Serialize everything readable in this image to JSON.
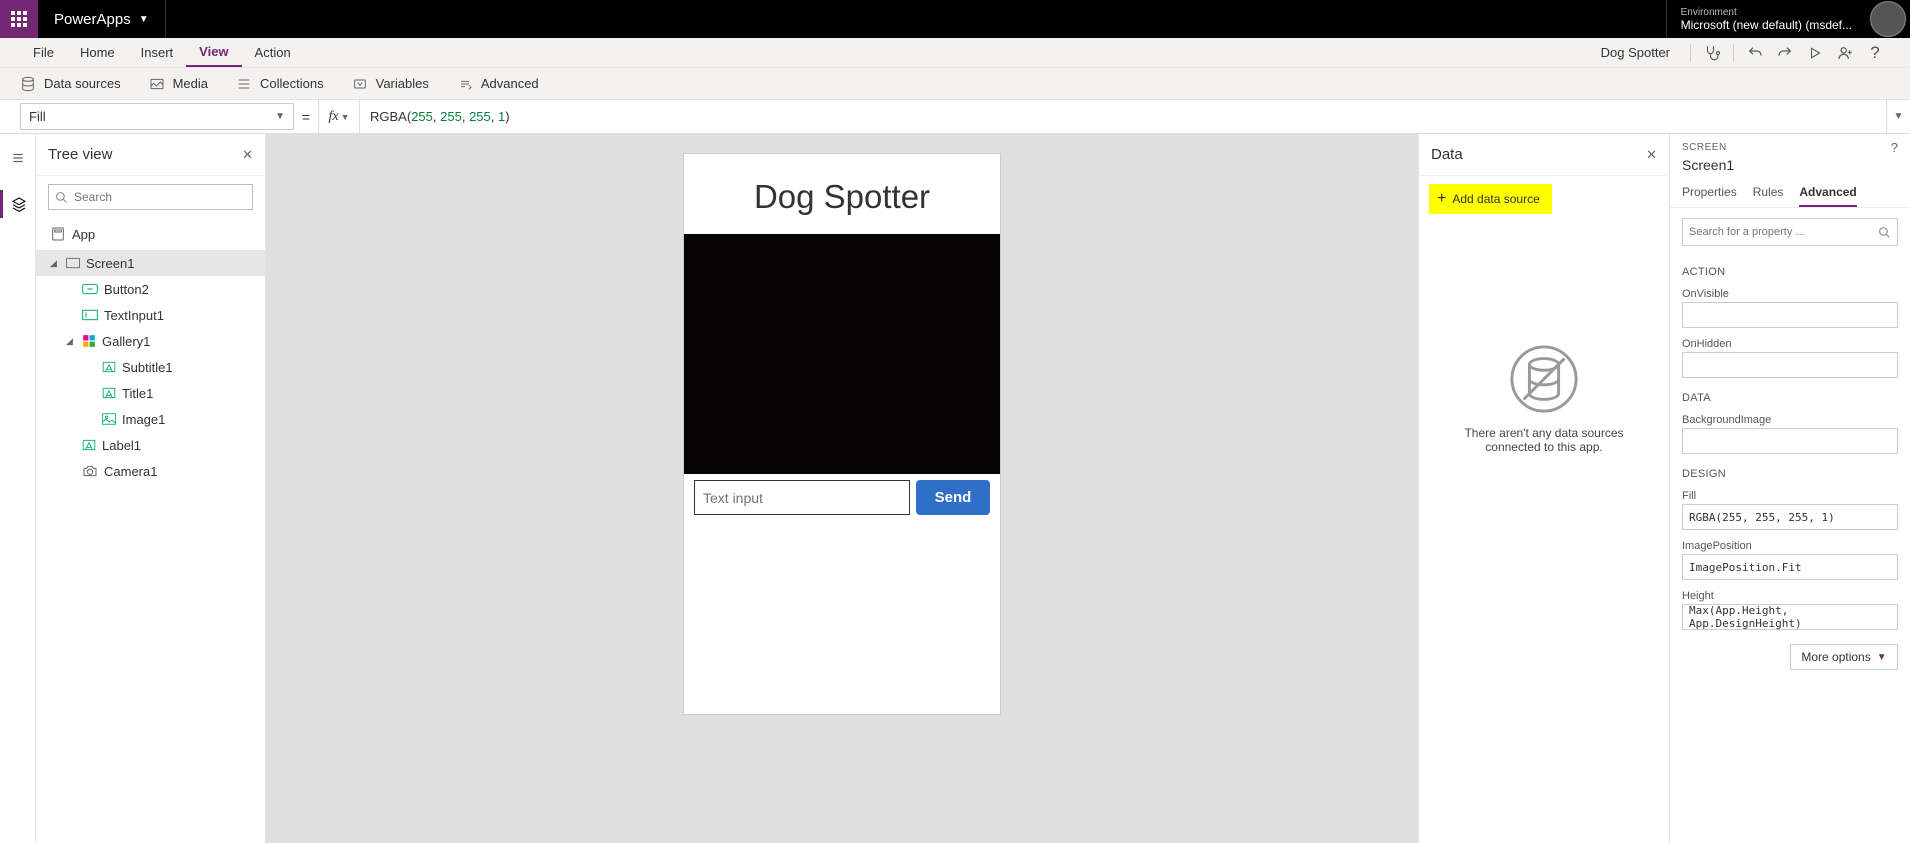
{
  "titlebar": {
    "app_name": "PowerApps",
    "env_label": "Environment",
    "env_name": "Microsoft (new default) (msdef..."
  },
  "menubar": {
    "items": [
      "File",
      "Home",
      "Insert",
      "View",
      "Action"
    ],
    "active_index": 3,
    "app_name_right": "Dog Spotter"
  },
  "ribbon": {
    "items": [
      "Data sources",
      "Media",
      "Collections",
      "Variables",
      "Advanced"
    ]
  },
  "formulabar": {
    "property": "Fill",
    "fx": "fx",
    "formula_fn": "RGBA",
    "formula_args": [
      "255",
      "255",
      "255",
      "1"
    ]
  },
  "tree": {
    "panel_title": "Tree view",
    "search_placeholder": "Search",
    "app_node": "App",
    "items": [
      {
        "name": "Screen1",
        "selected": true,
        "level": 1,
        "icon": "screen",
        "expando": "open"
      },
      {
        "name": "Button2",
        "level": 2,
        "icon": "button"
      },
      {
        "name": "TextInput1",
        "level": 2,
        "icon": "textinput"
      },
      {
        "name": "Gallery1",
        "level": 2,
        "icon": "gallery",
        "expando": "open"
      },
      {
        "name": "Subtitle1",
        "level": 3,
        "icon": "label"
      },
      {
        "name": "Title1",
        "level": 3,
        "icon": "label"
      },
      {
        "name": "Image1",
        "level": 3,
        "icon": "image"
      },
      {
        "name": "Label1",
        "level": 2,
        "icon": "label"
      },
      {
        "name": "Camera1",
        "level": 2,
        "icon": "camera"
      }
    ]
  },
  "canvas": {
    "heading": "Dog Spotter",
    "input_placeholder": "Text input",
    "send_label": "Send"
  },
  "data_panel": {
    "title": "Data",
    "add_btn": "Add data source",
    "empty_text": "There aren't any data sources connected to this app."
  },
  "advanced": {
    "screen_label": "SCREEN",
    "screen_name": "Screen1",
    "tabs": [
      "Properties",
      "Rules",
      "Advanced"
    ],
    "active_tab": 2,
    "search_placeholder": "Search for a property ...",
    "sections": {
      "action": "ACTION",
      "onvisible": "OnVisible",
      "onhidden": "OnHidden",
      "data": "DATA",
      "bgimage": "BackgroundImage",
      "design": "DESIGN",
      "fill": "Fill",
      "fill_val": "RGBA(255, 255, 255, 1)",
      "imagepos": "ImagePosition",
      "imagepos_val": "ImagePosition.Fit",
      "height": "Height",
      "height_val": "Max(App.Height, App.DesignHeight)"
    },
    "more_options": "More options"
  }
}
